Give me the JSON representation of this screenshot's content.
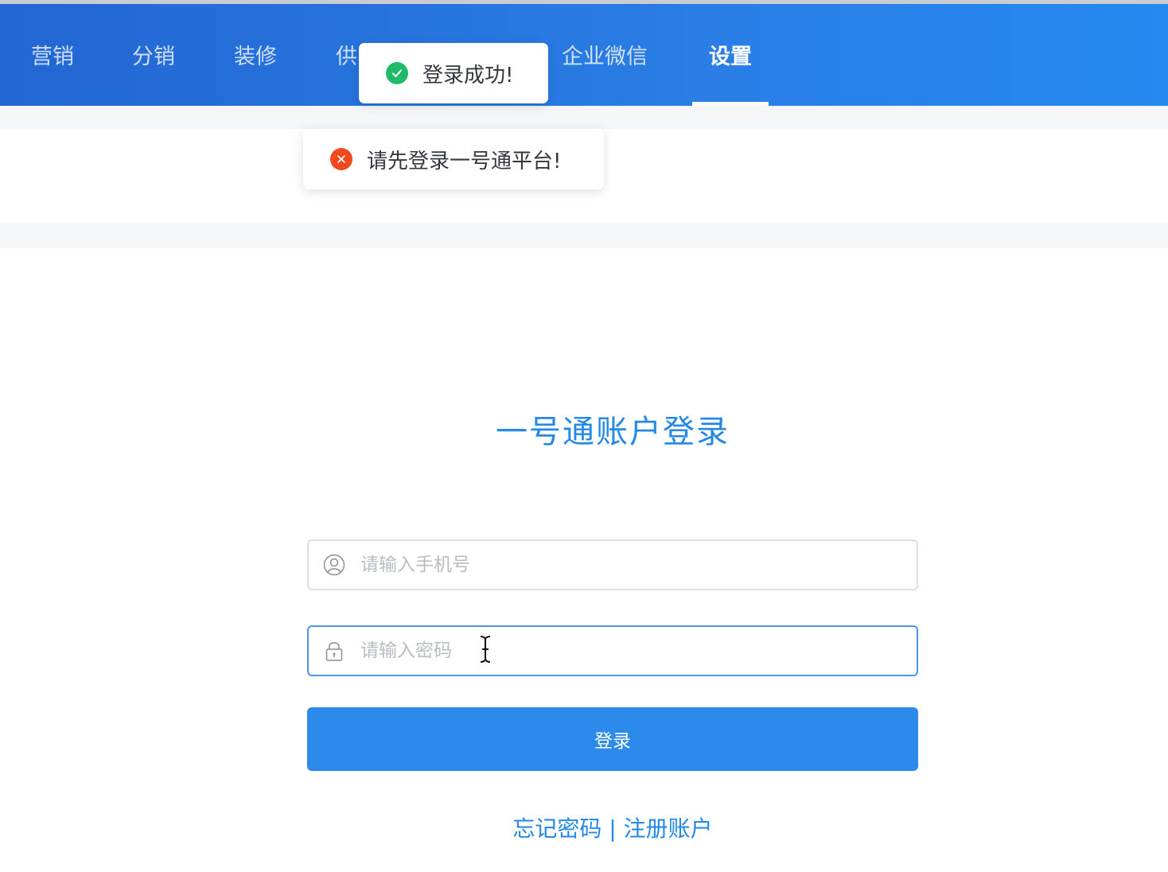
{
  "nav": {
    "items": [
      {
        "label": "营销"
      },
      {
        "label": "分销"
      },
      {
        "label": "装修"
      },
      {
        "label": "供"
      },
      {
        "label": "企业微信"
      },
      {
        "label": "设置"
      }
    ],
    "active_index": 5
  },
  "toasts": {
    "success": {
      "icon": "check-circle-icon",
      "text": "登录成功!"
    },
    "error": {
      "icon": "close-circle-icon",
      "text": "请先登录一号通平台!"
    }
  },
  "login": {
    "title": "一号通账户登录",
    "phone_placeholder": "请输入手机号",
    "phone_value": "",
    "password_placeholder": "请输入密码",
    "password_value": "",
    "submit_label": "登录",
    "forgot_link": "忘记密码",
    "separator": " | ",
    "register_link": "注册账户"
  },
  "colors": {
    "header_gradient_start": "#2266d3",
    "header_gradient_end": "#2489f0",
    "accent": "#2c8bea",
    "success": "#1fbb6b",
    "error": "#f0491f"
  }
}
